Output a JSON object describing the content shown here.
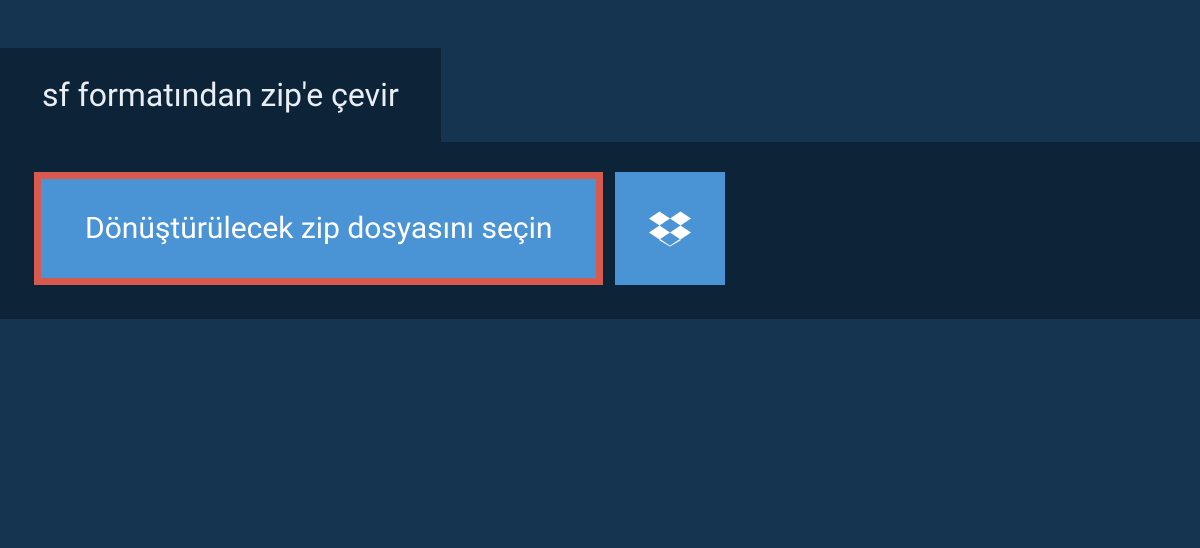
{
  "tab": {
    "label": "sf formatından zip'e çevir"
  },
  "panel": {
    "select_file_label": "Dönüştürülecek zip dosyasını seçin"
  },
  "colors": {
    "page_bg": "#143450",
    "panel_bg": "#0d2438",
    "button_bg": "#4a94d6",
    "button_border": "#d85a4f",
    "text_light": "#ffffff",
    "tab_text": "#e8eef3"
  }
}
